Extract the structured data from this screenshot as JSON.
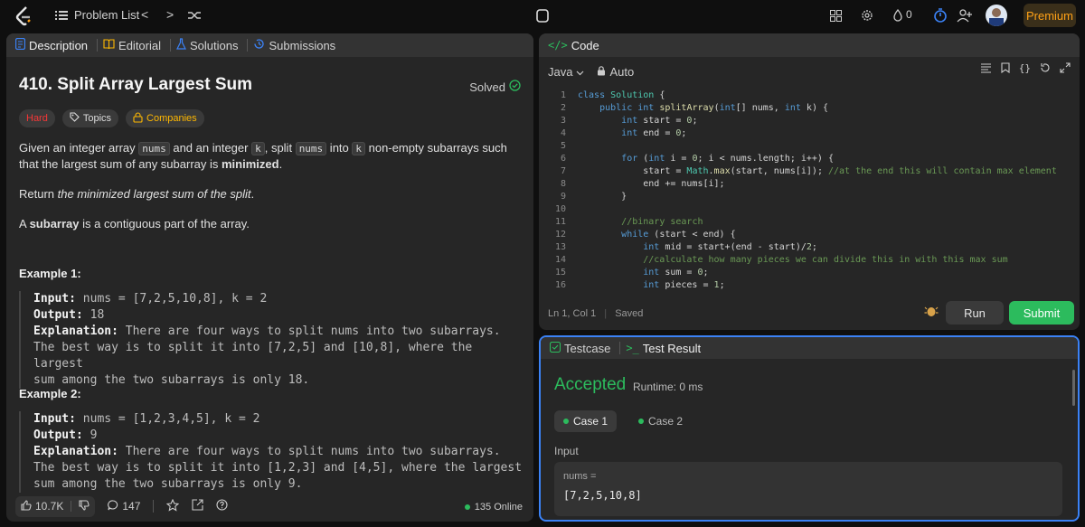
{
  "topbar": {
    "problem_list": "Problem List",
    "prev": "<",
    "next": ">",
    "notif_count": "0",
    "premium": "Premium"
  },
  "tabs": {
    "description": "Description",
    "editorial": "Editorial",
    "solutions": "Solutions",
    "submissions": "Submissions"
  },
  "problem": {
    "title": "410. Split Array Largest Sum",
    "solved": "Solved",
    "difficulty": "Hard",
    "topics": "Topics",
    "companies": "Companies",
    "p1_a": "Given an integer array ",
    "p1_nums": "nums",
    "p1_b": " and an integer ",
    "p1_k": "k",
    "p1_c": ", split ",
    "p1_nums2": "nums",
    "p1_d": " into ",
    "p1_k2": "k",
    "p1_e": " non-empty subarrays such that the largest sum of any subarray is ",
    "p1_min": "minimized",
    "p1_end": ".",
    "p2_a": "Return ",
    "p2_em": "the minimized largest sum of the split",
    "p2_end": ".",
    "p3_a": "A ",
    "p3_b": "subarray",
    "p3_c": " is a contiguous part of the array."
  },
  "examples": [
    {
      "title": "Example 1:",
      "input_label": "Input:",
      "input": " nums = [7,2,5,10,8], k = 2",
      "output_label": "Output:",
      "output": " 18",
      "expl_label": "Explanation:",
      "expl1": " There are four ways to split nums into two subarrays.",
      "expl2": "The best way is to split it into [7,2,5] and [10,8], where the largest",
      "expl3": "sum among the two subarrays is only 18."
    },
    {
      "title": "Example 2:",
      "input_label": "Input:",
      "input": " nums = [1,2,3,4,5], k = 2",
      "output_label": "Output:",
      "output": " 9",
      "expl_label": "Explanation:",
      "expl1": " There are four ways to split nums into two subarrays.",
      "expl2": "The best way is to split it into [1,2,3] and [4,5], where the largest",
      "expl3": "sum among the two subarrays is only 9."
    }
  ],
  "footer": {
    "likes": "10.7K",
    "comments": "147",
    "online": "135 Online"
  },
  "editor": {
    "title": "Code",
    "language": "Java",
    "mode": "Auto",
    "cursor": "Ln 1, Col 1",
    "saved": "Saved",
    "run": "Run",
    "submit": "Submit",
    "line_numbers": [
      "1",
      "2",
      "3",
      "4",
      "5",
      "6",
      "7",
      "8",
      "9",
      "10",
      "11",
      "12",
      "13",
      "14",
      "15",
      "16"
    ]
  },
  "testpanel": {
    "testcase_tab": "Testcase",
    "result_tab": "Test Result",
    "status": "Accepted",
    "runtime": "Runtime: 0 ms",
    "case1": "Case 1",
    "case2": "Case 2",
    "input_label": "Input",
    "var_label": "nums =",
    "var_value": "[7,2,5,10,8]"
  },
  "colors": {
    "accent_green": "#2cbb5d",
    "hard_red": "#f63737",
    "premium_orange": "#ffa116",
    "focus_blue": "#3b82f6"
  }
}
